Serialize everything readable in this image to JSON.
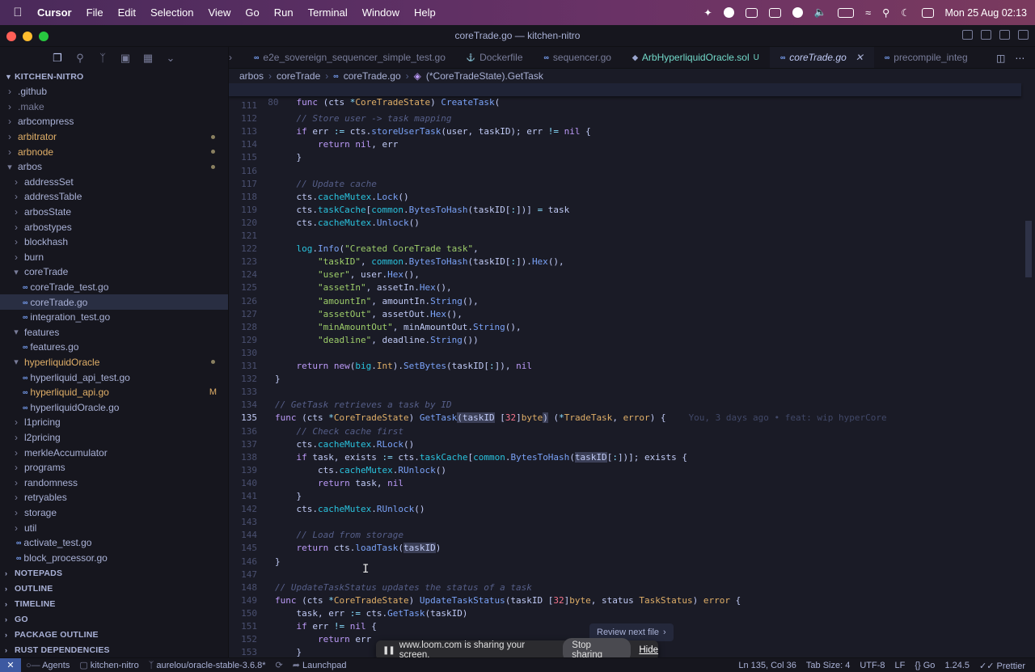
{
  "menubar": {
    "app": "Cursor",
    "items": [
      "File",
      "Edit",
      "Selection",
      "View",
      "Go",
      "Run",
      "Terminal",
      "Window",
      "Help"
    ],
    "datetime": "Mon 25 Aug  02:13"
  },
  "window": {
    "title": "coreTrade.go — kitchen-nitro"
  },
  "sidebar": {
    "root": "KITCHEN-NITRO",
    "tree": [
      {
        "label": ".github",
        "depth": 1,
        "type": "dir",
        "open": false
      },
      {
        "label": ".make",
        "depth": 1,
        "type": "dir",
        "open": false,
        "dim": true
      },
      {
        "label": "arbcompress",
        "depth": 1,
        "type": "dir",
        "open": false
      },
      {
        "label": "arbitrator",
        "depth": 1,
        "type": "dir",
        "open": false,
        "yellow": true,
        "dot": true
      },
      {
        "label": "arbnode",
        "depth": 1,
        "type": "dir",
        "open": false,
        "yellow": true,
        "dot": true
      },
      {
        "label": "arbos",
        "depth": 1,
        "type": "dir",
        "open": true,
        "dot": true
      },
      {
        "label": "addressSet",
        "depth": 2,
        "type": "dir",
        "open": false
      },
      {
        "label": "addressTable",
        "depth": 2,
        "type": "dir",
        "open": false
      },
      {
        "label": "arbosState",
        "depth": 2,
        "type": "dir",
        "open": false
      },
      {
        "label": "arbostypes",
        "depth": 2,
        "type": "dir",
        "open": false
      },
      {
        "label": "blockhash",
        "depth": 2,
        "type": "dir",
        "open": false
      },
      {
        "label": "burn",
        "depth": 2,
        "type": "dir",
        "open": false
      },
      {
        "label": "coreTrade",
        "depth": 2,
        "type": "dir",
        "open": true
      },
      {
        "label": "coreTrade_test.go",
        "depth": 3,
        "type": "go"
      },
      {
        "label": "coreTrade.go",
        "depth": 3,
        "type": "go",
        "selected": true
      },
      {
        "label": "integration_test.go",
        "depth": 3,
        "type": "go"
      },
      {
        "label": "features",
        "depth": 2,
        "type": "dir",
        "open": true
      },
      {
        "label": "features.go",
        "depth": 3,
        "type": "go"
      },
      {
        "label": "hyperliquidOracle",
        "depth": 2,
        "type": "dir",
        "open": true,
        "yellow": true,
        "dot": true
      },
      {
        "label": "hyperliquid_api_test.go",
        "depth": 3,
        "type": "go"
      },
      {
        "label": "hyperliquid_api.go",
        "depth": 3,
        "type": "go",
        "yellow": true,
        "mark": "M"
      },
      {
        "label": "hyperliquidOracle.go",
        "depth": 3,
        "type": "go"
      },
      {
        "label": "l1pricing",
        "depth": 2,
        "type": "dir",
        "open": false
      },
      {
        "label": "l2pricing",
        "depth": 2,
        "type": "dir",
        "open": false
      },
      {
        "label": "merkleAccumulator",
        "depth": 2,
        "type": "dir",
        "open": false
      },
      {
        "label": "programs",
        "depth": 2,
        "type": "dir",
        "open": false
      },
      {
        "label": "randomness",
        "depth": 2,
        "type": "dir",
        "open": false
      },
      {
        "label": "retryables",
        "depth": 2,
        "type": "dir",
        "open": false
      },
      {
        "label": "storage",
        "depth": 2,
        "type": "dir",
        "open": false
      },
      {
        "label": "util",
        "depth": 2,
        "type": "dir",
        "open": false
      },
      {
        "label": "activate_test.go",
        "depth": 2,
        "type": "go"
      },
      {
        "label": "block_processor.go",
        "depth": 2,
        "type": "go"
      }
    ],
    "sections": [
      "NOTEPADS",
      "OUTLINE",
      "TIMELINE",
      "GO",
      "PACKAGE OUTLINE",
      "RUST DEPENDENCIES"
    ]
  },
  "tabs": [
    {
      "label": "e2e_sovereign_sequencer_simple_test.go",
      "icon": "go"
    },
    {
      "label": "Dockerfile",
      "icon": "docker"
    },
    {
      "label": "sequencer.go",
      "icon": "go"
    },
    {
      "label": "ArbHyperliquidOracle.sol",
      "icon": "sol",
      "modified": true,
      "mark": "U"
    },
    {
      "label": "coreTrade.go",
      "icon": "go",
      "active": true
    },
    {
      "label": "precompile_integ",
      "icon": "go"
    }
  ],
  "breadcrumb": [
    "arbos",
    "coreTrade",
    "coreTrade.go",
    "(*CoreTradeState).GetTask"
  ],
  "editor": {
    "sticky_line": 80,
    "lines_start": 111,
    "current_line": 135,
    "blame": "You, 3 days ago • feat: wip hyperCore"
  },
  "review_button": "Review next file",
  "loom": {
    "message": "www.loom.com is sharing your screen.",
    "stop": "Stop sharing",
    "hide": "Hide"
  },
  "statusbar": {
    "left": [
      "Agents",
      "kitchen-nitro",
      "aurelou/oracle-stable-3.6.8*",
      "Launchpad"
    ],
    "right": [
      "Ln 135, Col 36",
      "Tab Size: 4",
      "UTF-8",
      "LF",
      "Go",
      "1.24.5",
      "Prettier"
    ]
  }
}
